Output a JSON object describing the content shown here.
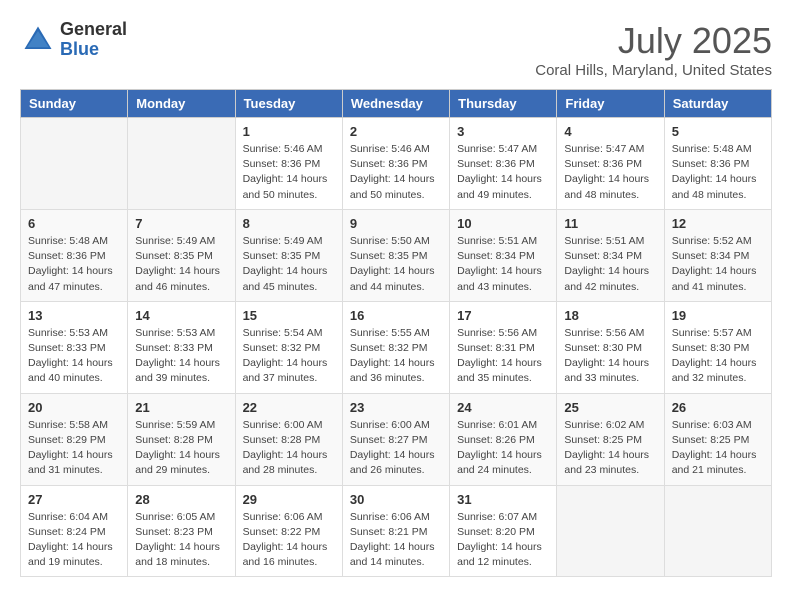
{
  "header": {
    "logo_general": "General",
    "logo_blue": "Blue",
    "title": "July 2025",
    "location": "Coral Hills, Maryland, United States"
  },
  "days_of_week": [
    "Sunday",
    "Monday",
    "Tuesday",
    "Wednesday",
    "Thursday",
    "Friday",
    "Saturday"
  ],
  "weeks": [
    [
      {
        "day": "",
        "info": ""
      },
      {
        "day": "",
        "info": ""
      },
      {
        "day": "1",
        "info": "Sunrise: 5:46 AM\nSunset: 8:36 PM\nDaylight: 14 hours and 50 minutes."
      },
      {
        "day": "2",
        "info": "Sunrise: 5:46 AM\nSunset: 8:36 PM\nDaylight: 14 hours and 50 minutes."
      },
      {
        "day": "3",
        "info": "Sunrise: 5:47 AM\nSunset: 8:36 PM\nDaylight: 14 hours and 49 minutes."
      },
      {
        "day": "4",
        "info": "Sunrise: 5:47 AM\nSunset: 8:36 PM\nDaylight: 14 hours and 48 minutes."
      },
      {
        "day": "5",
        "info": "Sunrise: 5:48 AM\nSunset: 8:36 PM\nDaylight: 14 hours and 48 minutes."
      }
    ],
    [
      {
        "day": "6",
        "info": "Sunrise: 5:48 AM\nSunset: 8:36 PM\nDaylight: 14 hours and 47 minutes."
      },
      {
        "day": "7",
        "info": "Sunrise: 5:49 AM\nSunset: 8:35 PM\nDaylight: 14 hours and 46 minutes."
      },
      {
        "day": "8",
        "info": "Sunrise: 5:49 AM\nSunset: 8:35 PM\nDaylight: 14 hours and 45 minutes."
      },
      {
        "day": "9",
        "info": "Sunrise: 5:50 AM\nSunset: 8:35 PM\nDaylight: 14 hours and 44 minutes."
      },
      {
        "day": "10",
        "info": "Sunrise: 5:51 AM\nSunset: 8:34 PM\nDaylight: 14 hours and 43 minutes."
      },
      {
        "day": "11",
        "info": "Sunrise: 5:51 AM\nSunset: 8:34 PM\nDaylight: 14 hours and 42 minutes."
      },
      {
        "day": "12",
        "info": "Sunrise: 5:52 AM\nSunset: 8:34 PM\nDaylight: 14 hours and 41 minutes."
      }
    ],
    [
      {
        "day": "13",
        "info": "Sunrise: 5:53 AM\nSunset: 8:33 PM\nDaylight: 14 hours and 40 minutes."
      },
      {
        "day": "14",
        "info": "Sunrise: 5:53 AM\nSunset: 8:33 PM\nDaylight: 14 hours and 39 minutes."
      },
      {
        "day": "15",
        "info": "Sunrise: 5:54 AM\nSunset: 8:32 PM\nDaylight: 14 hours and 37 minutes."
      },
      {
        "day": "16",
        "info": "Sunrise: 5:55 AM\nSunset: 8:32 PM\nDaylight: 14 hours and 36 minutes."
      },
      {
        "day": "17",
        "info": "Sunrise: 5:56 AM\nSunset: 8:31 PM\nDaylight: 14 hours and 35 minutes."
      },
      {
        "day": "18",
        "info": "Sunrise: 5:56 AM\nSunset: 8:30 PM\nDaylight: 14 hours and 33 minutes."
      },
      {
        "day": "19",
        "info": "Sunrise: 5:57 AM\nSunset: 8:30 PM\nDaylight: 14 hours and 32 minutes."
      }
    ],
    [
      {
        "day": "20",
        "info": "Sunrise: 5:58 AM\nSunset: 8:29 PM\nDaylight: 14 hours and 31 minutes."
      },
      {
        "day": "21",
        "info": "Sunrise: 5:59 AM\nSunset: 8:28 PM\nDaylight: 14 hours and 29 minutes."
      },
      {
        "day": "22",
        "info": "Sunrise: 6:00 AM\nSunset: 8:28 PM\nDaylight: 14 hours and 28 minutes."
      },
      {
        "day": "23",
        "info": "Sunrise: 6:00 AM\nSunset: 8:27 PM\nDaylight: 14 hours and 26 minutes."
      },
      {
        "day": "24",
        "info": "Sunrise: 6:01 AM\nSunset: 8:26 PM\nDaylight: 14 hours and 24 minutes."
      },
      {
        "day": "25",
        "info": "Sunrise: 6:02 AM\nSunset: 8:25 PM\nDaylight: 14 hours and 23 minutes."
      },
      {
        "day": "26",
        "info": "Sunrise: 6:03 AM\nSunset: 8:25 PM\nDaylight: 14 hours and 21 minutes."
      }
    ],
    [
      {
        "day": "27",
        "info": "Sunrise: 6:04 AM\nSunset: 8:24 PM\nDaylight: 14 hours and 19 minutes."
      },
      {
        "day": "28",
        "info": "Sunrise: 6:05 AM\nSunset: 8:23 PM\nDaylight: 14 hours and 18 minutes."
      },
      {
        "day": "29",
        "info": "Sunrise: 6:06 AM\nSunset: 8:22 PM\nDaylight: 14 hours and 16 minutes."
      },
      {
        "day": "30",
        "info": "Sunrise: 6:06 AM\nSunset: 8:21 PM\nDaylight: 14 hours and 14 minutes."
      },
      {
        "day": "31",
        "info": "Sunrise: 6:07 AM\nSunset: 8:20 PM\nDaylight: 14 hours and 12 minutes."
      },
      {
        "day": "",
        "info": ""
      },
      {
        "day": "",
        "info": ""
      }
    ]
  ]
}
